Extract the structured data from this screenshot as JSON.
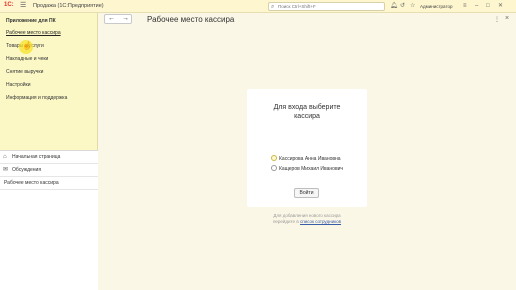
{
  "topbar": {
    "logo": "1C:",
    "app_title": "Продажа (1С:Предприятие)",
    "search_placeholder": "Поиск Ctrl+Shift+F",
    "user": "Администратор"
  },
  "sidebar": {
    "heading": "Приложение для ПК",
    "items": [
      {
        "label": "Рабочее место кассира",
        "active": true
      },
      {
        "label": "Товары и услуги"
      },
      {
        "label": "Накладные и чеки"
      },
      {
        "label": "Снятие выручки"
      },
      {
        "label": "Настройки"
      },
      {
        "label": "Информация и поддержка"
      }
    ]
  },
  "open_windows": [
    {
      "label": "Начальная страница",
      "icon": "home-icon"
    },
    {
      "label": "Обсуждения",
      "icon": "chat-icon"
    },
    {
      "label": "Рабочее место кассира"
    }
  ],
  "main": {
    "title": "Рабочее место кассира",
    "panel": {
      "heading_line1": "Для входа выберите",
      "heading_line2": "кассира",
      "cashiers": [
        {
          "name": "Кассирова Анна Ивановна",
          "highlighted": true
        },
        {
          "name": "Кащеров Михаил Иванович",
          "highlighted": false
        }
      ],
      "login_label": "Войти"
    },
    "hint_line1": "Для добавления нового кассира",
    "hint_prefix": "перейдите в ",
    "hint_link": "список сотрудников"
  },
  "colors": {
    "sidebar_bg": "#fbf8c6",
    "main_bg": "#fbf7e6",
    "logo_red": "#e0312b",
    "link_blue": "#3a5da8"
  }
}
